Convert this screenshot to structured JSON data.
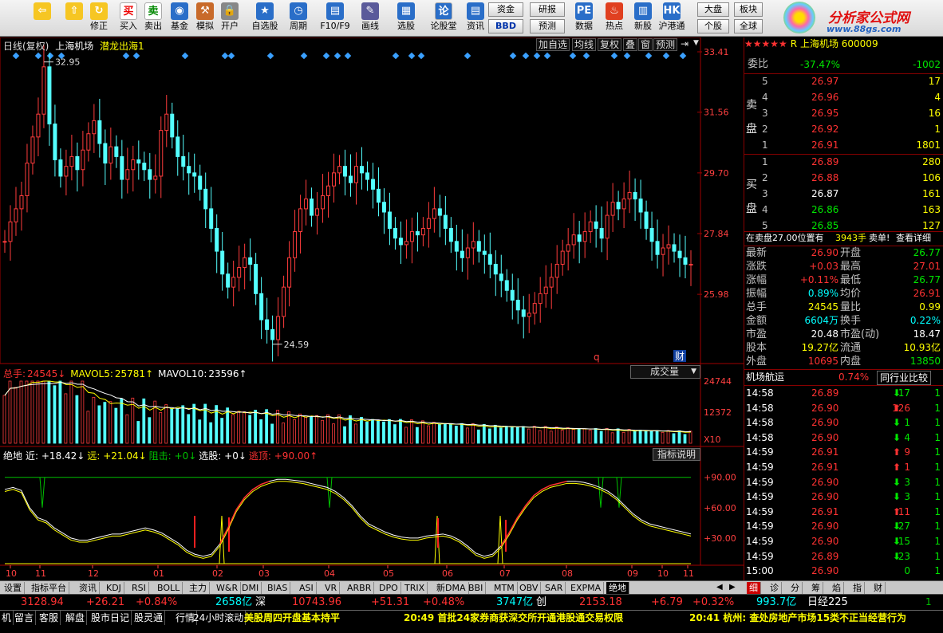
{
  "toolbar": {
    "buttons": [
      {
        "label": "",
        "icon": "back-arrow-icon"
      },
      {
        "label": "",
        "icon": "up-down-arrow-icon"
      },
      {
        "label": "修正",
        "icon": "refresh-icon"
      },
      {
        "label": "买入",
        "icon": "buy-icon",
        "glyph": "买"
      },
      {
        "label": "卖出",
        "icon": "sell-icon",
        "glyph": "卖"
      },
      {
        "label": "基金",
        "icon": "fund-icon"
      },
      {
        "label": "模拟",
        "icon": "hammer-icon"
      },
      {
        "label": "开户",
        "icon": "lock-icon"
      },
      {
        "label": "自选股",
        "icon": "favorites-icon"
      },
      {
        "label": "周期",
        "icon": "clock-icon"
      },
      {
        "label": "F10/F9",
        "icon": "f10-icon"
      },
      {
        "label": "画线",
        "icon": "pen-icon"
      },
      {
        "label": "选股",
        "icon": "select-stock-icon"
      },
      {
        "label": "论股堂",
        "icon": "forum-icon",
        "glyph": "论"
      },
      {
        "label": "资讯",
        "icon": "news-icon"
      },
      {
        "label": "数据",
        "icon": "data-icon"
      },
      {
        "label": "热点",
        "icon": "hot-icon"
      },
      {
        "label": "新股",
        "icon": "new-stock-icon"
      },
      {
        "label": "沪港通",
        "icon": "hk-connect-icon"
      }
    ],
    "small_buttons": [
      "资金",
      "BBD",
      "研报",
      "预测",
      "大盘",
      "个股",
      "板块",
      "全球"
    ],
    "logo_text": "分析家公式网",
    "logo_url": "www.88gs.com"
  },
  "chart_header": {
    "period": "日线(复权)",
    "stock_name": "上海机场",
    "indicator": "潜龙出海1",
    "right_buttons": [
      "加自选",
      "均线",
      "复权",
      "叠",
      "窗",
      "预测"
    ]
  },
  "volume_header": {
    "items": [
      {
        "label": "总手:",
        "value": "24545↓",
        "color": "#ff3232"
      },
      {
        "label": "MAVOL5:",
        "value": "25781↑",
        "color": "#ffff00"
      },
      {
        "label": "MAVOL10:",
        "value": "23596↑",
        "color": "#ffffff"
      }
    ],
    "selector": "成交量"
  },
  "indicator_header": {
    "name": "绝地",
    "items": [
      {
        "text": "近: +18.42↓",
        "color": "#ffffff"
      },
      {
        "text": "远: +21.04↓",
        "color": "#ffff00"
      },
      {
        "text": "阻击: +0↓",
        "color": "#00c000"
      },
      {
        "text": "选股: +0↓",
        "color": "#ffffff"
      },
      {
        "text": "逃顶: +90.00↑",
        "color": "#ff3232"
      }
    ],
    "button": "指标说明"
  },
  "chart_data": {
    "type": "candlestick",
    "price_axis_ticks": [
      "33.41",
      "31.56",
      "29.70",
      "27.84",
      "25.98"
    ],
    "price_range": [
      24.2,
      33.41
    ],
    "high_marker": "32.95",
    "low_marker": "24.59",
    "markers_bottom": [
      "q",
      "财"
    ],
    "volume_axis_ticks": [
      "24744",
      "12372"
    ],
    "volume_unit": "X10",
    "indicator_axis_ticks": [
      "+90.00",
      "+60.00",
      "+30.00"
    ],
    "x_ticks": [
      "10",
      "11",
      "12",
      "01",
      "02",
      "03",
      "04",
      "05",
      "06",
      "07",
      "08",
      "09",
      "10",
      "11"
    ],
    "close_series": [
      27.6,
      28.2,
      28.6,
      29.0,
      30.0,
      30.8,
      31.5,
      32.95,
      31.2,
      30.1,
      29.6,
      29.9,
      30.2,
      29.8,
      30.4,
      30.9,
      31.3,
      30.6,
      30.0,
      30.5,
      30.2,
      29.5,
      29.8,
      30.1,
      30.0,
      29.8,
      29.5,
      29.6,
      31.0,
      31.5,
      30.8,
      30.2,
      29.9,
      29.7,
      29.6,
      29.2,
      28.6,
      28.0,
      27.3,
      26.6,
      26.2,
      26.5,
      26.8,
      27.1,
      26.9,
      26.0,
      25.2,
      24.9,
      24.59,
      25.3,
      26.2,
      27.1,
      27.9,
      28.6,
      28.9,
      28.4,
      28.6,
      29.0,
      29.3,
      29.7,
      29.9,
      29.6,
      29.4,
      29.9,
      29.7,
      29.5,
      29.2,
      28.8,
      28.5,
      28.0,
      27.7,
      27.5,
      27.6,
      27.9,
      27.8,
      28.0,
      28.3,
      28.6,
      28.4,
      28.0,
      27.6,
      27.3,
      27.1,
      27.4,
      27.6,
      27.3,
      27.2,
      26.9,
      26.6,
      26.4,
      26.1,
      25.8,
      25.5,
      25.3,
      25.4,
      25.7,
      26.0,
      26.2,
      26.5,
      26.9,
      27.3,
      27.5,
      27.8,
      27.6,
      27.9,
      28.2,
      28.0,
      27.7,
      28.4,
      28.8,
      28.6,
      28.9,
      29.1,
      28.9,
      28.5,
      28.0,
      27.6,
      27.2,
      27.4,
      27.5,
      27.3,
      27.1,
      26.9,
      26.9
    ]
  },
  "quote_panel": {
    "stars": "★★★★★",
    "title": "R 上海机场 600009",
    "ratio_label": "委比",
    "ratio_value": "-37.47%",
    "ratio_diff": "-1002",
    "sell_label": "卖盘",
    "buy_label": "买盘",
    "sells": [
      {
        "n": "5",
        "p": "26.97",
        "v": "17"
      },
      {
        "n": "4",
        "p": "26.96",
        "v": "4"
      },
      {
        "n": "3",
        "p": "26.95",
        "v": "16"
      },
      {
        "n": "2",
        "p": "26.92",
        "v": "1"
      },
      {
        "n": "1",
        "p": "26.91",
        "v": "1801"
      }
    ],
    "buys": [
      {
        "n": "1",
        "p": "26.89",
        "v": "280"
      },
      {
        "n": "2",
        "p": "26.88",
        "v": "106"
      },
      {
        "n": "3",
        "p": "26.87",
        "v": "161"
      },
      {
        "n": "4",
        "p": "26.86",
        "v": "163"
      },
      {
        "n": "5",
        "p": "26.85",
        "v": "127"
      }
    ],
    "notice_text": "在卖盘27.00位置有",
    "notice_qty": "3943手",
    "notice_action": "卖单!",
    "notice_link": "查看详细",
    "stats": [
      {
        "l1": "最新",
        "v1": "26.90",
        "c1": "red",
        "l2": "开盘",
        "v2": "26.77",
        "c2": "green"
      },
      {
        "l1": "涨跌",
        "v1": "+0.03",
        "c1": "red",
        "l2": "最高",
        "v2": "27.01",
        "c2": "red"
      },
      {
        "l1": "涨幅",
        "v1": "+0.11%",
        "c1": "red",
        "l2": "最低",
        "v2": "26.77",
        "c2": "green"
      },
      {
        "l1": "振幅",
        "v1": "0.89%",
        "c1": "cyan",
        "l2": "均价",
        "v2": "26.91",
        "c2": "red"
      },
      {
        "l1": "总手",
        "v1": "24545",
        "c1": "yellow",
        "l2": "量比",
        "v2": "0.99",
        "c2": "yellow"
      },
      {
        "l1": "金额",
        "v1": "6604万",
        "c1": "cyan",
        "l2": "换手",
        "v2": "0.22%",
        "c2": "cyan"
      },
      {
        "l1": "市盈",
        "v1": "20.48",
        "c1": "white",
        "l2": "市盈(动)",
        "v2": "18.47",
        "c2": "white"
      },
      {
        "l1": "股本",
        "v1": "19.27亿",
        "c1": "yellow",
        "l2": "流通",
        "v2": "10.93亿",
        "c2": "yellow"
      },
      {
        "l1": "外盘",
        "v1": "10695",
        "c1": "red",
        "l2": "内盘",
        "v2": "13850",
        "c2": "green"
      }
    ],
    "sector_name": "机场航运",
    "sector_change": "0.74%",
    "sector_button": "同行业比较",
    "ticks": [
      {
        "t": "14:58",
        "p": "26.89",
        "v": "17",
        "d": "down",
        "c": "1"
      },
      {
        "t": "14:58",
        "p": "26.90",
        "v": "126",
        "d": "up",
        "c": "1"
      },
      {
        "t": "14:58",
        "p": "26.90",
        "v": "1",
        "d": "down",
        "c": "1"
      },
      {
        "t": "14:58",
        "p": "26.90",
        "v": "4",
        "d": "down",
        "c": "1"
      },
      {
        "t": "14:59",
        "p": "26.91",
        "v": "9",
        "d": "up",
        "c": "1"
      },
      {
        "t": "14:59",
        "p": "26.91",
        "v": "1",
        "d": "up",
        "c": "1"
      },
      {
        "t": "14:59",
        "p": "26.90",
        "v": "3",
        "d": "down",
        "c": "1"
      },
      {
        "t": "14:59",
        "p": "26.90",
        "v": "3",
        "d": "down",
        "c": "1"
      },
      {
        "t": "14:59",
        "p": "26.91",
        "v": "11",
        "d": "up",
        "c": "1"
      },
      {
        "t": "14:59",
        "p": "26.90",
        "v": "27",
        "d": "down",
        "c": "1"
      },
      {
        "t": "14:59",
        "p": "26.90",
        "v": "15",
        "d": "down",
        "c": "1"
      },
      {
        "t": "14:59",
        "p": "26.89",
        "v": "23",
        "d": "down",
        "c": "1"
      },
      {
        "t": "15:00",
        "p": "26.90",
        "v": "0",
        "d": "none",
        "c": "1"
      }
    ],
    "bottom_tabs": [
      "细",
      "诊",
      "分",
      "筹",
      "焰",
      "指",
      "财"
    ]
  },
  "indicator_tabs": [
    "设置",
    "指标平台",
    "资讯",
    "KDJ",
    "RSI",
    "BOLL",
    "主力",
    "W&R",
    "DMI",
    "BIAS",
    "ASI",
    "VR",
    "ARBR",
    "DPO",
    "TRIX",
    "新DMA",
    "BBI",
    "MTM",
    "OBV",
    "SAR",
    "EXPMA",
    "绝地"
  ],
  "status_bar": [
    {
      "text": "3128.94",
      "color": "#ff3232"
    },
    {
      "text": "+26.21",
      "color": "#ff3232"
    },
    {
      "text": "+0.84%",
      "color": "#ff3232"
    },
    {
      "text": "2658亿",
      "color": "#00ffff"
    },
    {
      "text": "深",
      "color": "#ffffff"
    },
    {
      "text": "10743.96",
      "color": "#ff3232"
    },
    {
      "text": "+51.31",
      "color": "#ff3232"
    },
    {
      "text": "+0.48%",
      "color": "#ff3232"
    },
    {
      "text": "3747亿",
      "color": "#00ffff"
    },
    {
      "text": "创",
      "color": "#ffffff"
    },
    {
      "text": "2153.18",
      "color": "#ff3232"
    },
    {
      "text": "+6.79",
      "color": "#ff3232"
    },
    {
      "text": "+0.32%",
      "color": "#ff3232"
    },
    {
      "text": "993.7亿",
      "color": "#00ffff"
    },
    {
      "text": "日经225",
      "color": "#ffffff"
    }
  ],
  "news_bar": {
    "buttons": [
      "机",
      "留言",
      "客服",
      "解盘",
      "股市日记",
      "股灵通",
      "行情",
      "24小时滚动"
    ],
    "items": [
      {
        "text": "美股周四开盘基本持平",
        "color": "#ffff00"
      },
      {
        "text": "20:49 首批24家券商获深交所开通港股通交易权限",
        "color": "#ffff00"
      },
      {
        "text": "20:41 杭州: 查处房地产市场15类不正当经营行为",
        "color": "#ffff00"
      }
    ]
  }
}
